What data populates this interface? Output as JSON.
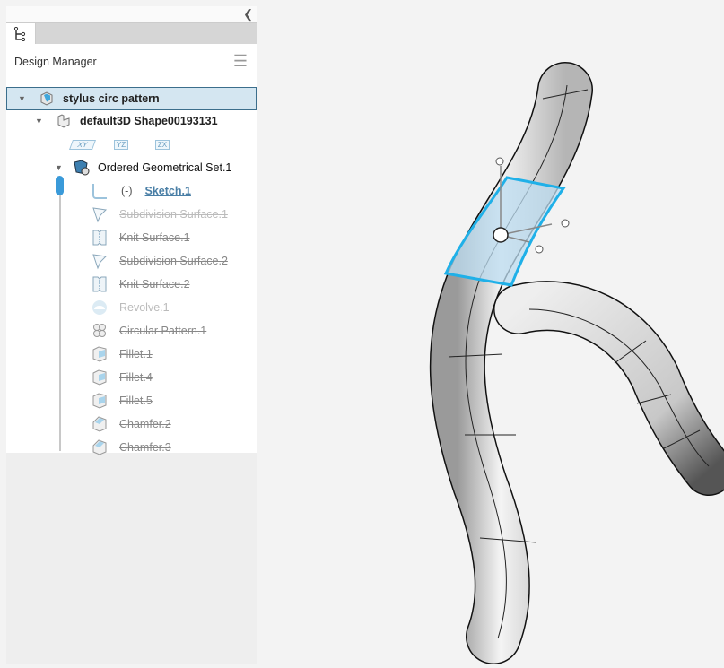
{
  "panel": {
    "collapse_icon": "chevron-left-icon",
    "tab_icon": "tree-icon",
    "title": "Design Manager",
    "menu_icon": "hamburger-icon"
  },
  "tree": {
    "root": {
      "label": "stylus circ pattern",
      "icon": "product-icon"
    },
    "shape": {
      "label": "default3D Shape00193131",
      "icon": "shape-icon"
    },
    "planes": [
      "XY",
      "YZ",
      "ZX"
    ],
    "geoset": {
      "label": "Ordered Geometrical Set.1",
      "icon": "geoset-icon"
    },
    "sketch": {
      "prefix": "(-)",
      "label": "Sketch.1",
      "icon": "sketch-icon"
    },
    "features": [
      {
        "label": "Subdivision Surface.1",
        "icon": "subdivision-icon"
      },
      {
        "label": "Knit Surface.1",
        "icon": "knit-icon"
      },
      {
        "label": "Subdivision Surface.2",
        "icon": "subdivision-icon"
      },
      {
        "label": "Knit Surface.2",
        "icon": "knit-icon"
      },
      {
        "label": "Revolve.1",
        "icon": "revolve-icon"
      },
      {
        "label": "Circular Pattern.1",
        "icon": "circular-pattern-icon"
      },
      {
        "label": "Fillet.1",
        "icon": "fillet-icon"
      },
      {
        "label": "Fillet.4",
        "icon": "fillet-icon"
      },
      {
        "label": "Fillet.5",
        "icon": "fillet-icon"
      },
      {
        "label": "Chamfer.2",
        "icon": "chamfer-icon"
      },
      {
        "label": "Chamfer.3",
        "icon": "chamfer-icon"
      }
    ]
  },
  "colors": {
    "accent": "#3a9ad9",
    "selection": "#d4e6f1",
    "highlight": "#1fb0e8"
  }
}
